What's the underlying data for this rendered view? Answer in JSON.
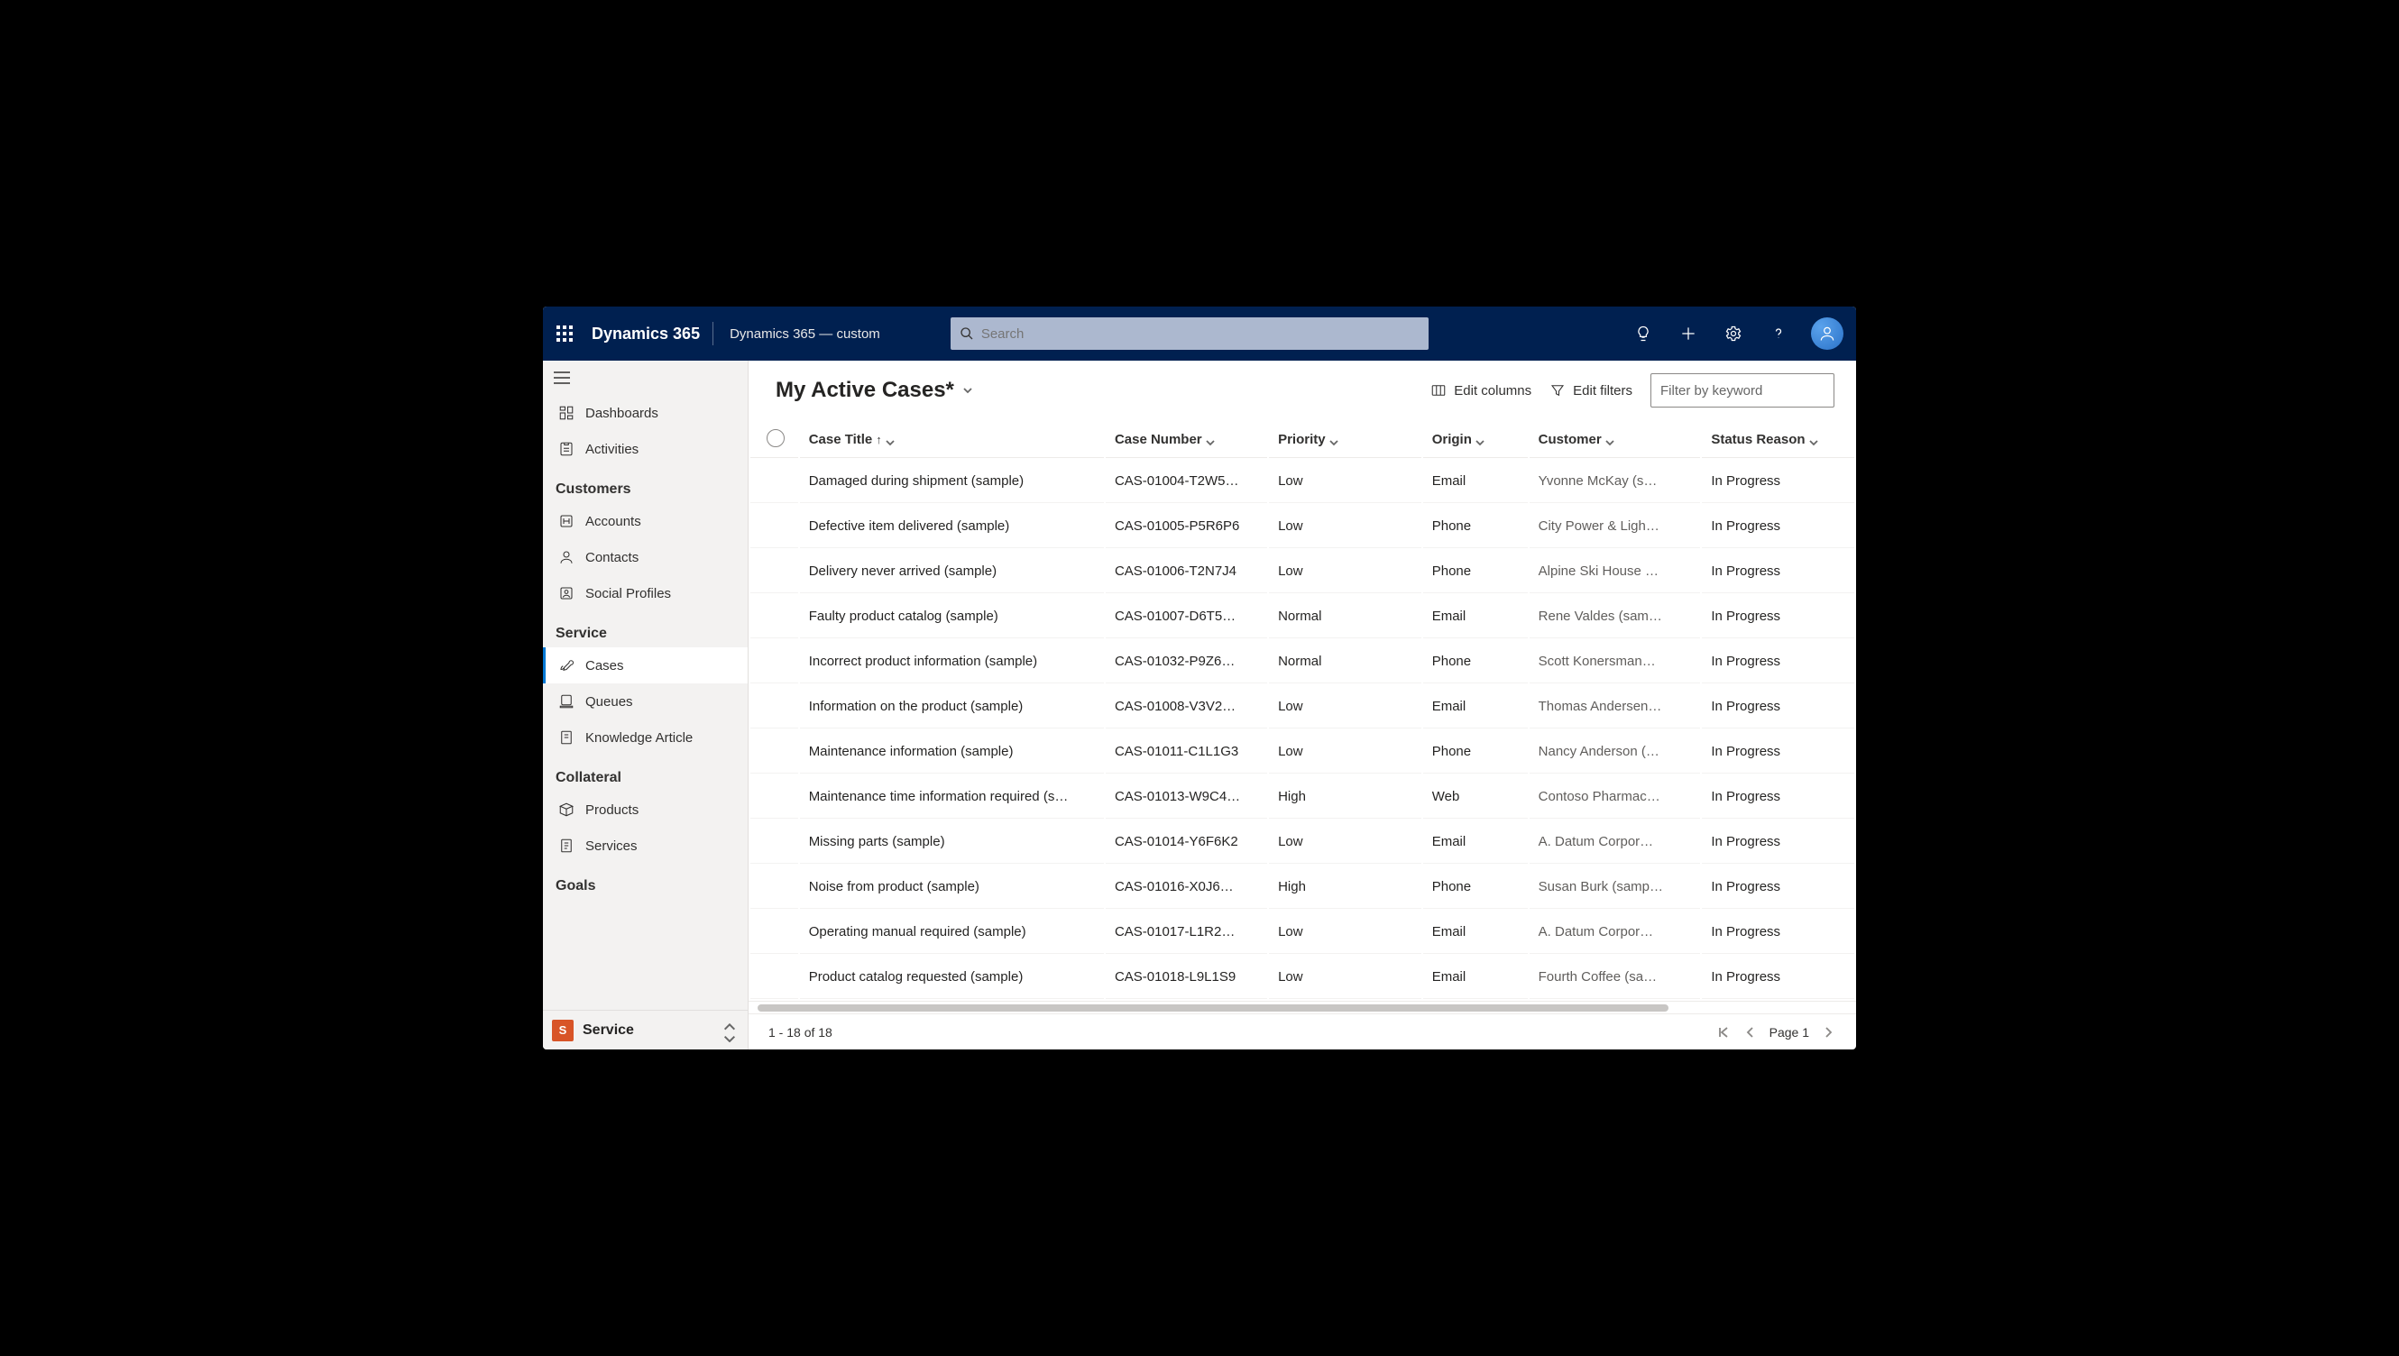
{
  "topnav": {
    "brand": "Dynamics 365",
    "subbrand": "Dynamics 365 — custom",
    "search_placeholder": "Search"
  },
  "sidebar": {
    "top": [
      {
        "label": "Dashboards",
        "icon": "dashboards"
      },
      {
        "label": "Activities",
        "icon": "activities"
      }
    ],
    "groups": [
      {
        "title": "Customers",
        "items": [
          {
            "label": "Accounts",
            "icon": "accounts"
          },
          {
            "label": "Contacts",
            "icon": "contacts"
          },
          {
            "label": "Social Profiles",
            "icon": "social"
          }
        ]
      },
      {
        "title": "Service",
        "items": [
          {
            "label": "Cases",
            "icon": "cases",
            "selected": true
          },
          {
            "label": "Queues",
            "icon": "queues"
          },
          {
            "label": "Knowledge Article",
            "icon": "knowledge"
          }
        ]
      },
      {
        "title": "Collateral",
        "items": [
          {
            "label": "Products",
            "icon": "products"
          },
          {
            "label": "Services",
            "icon": "services"
          }
        ]
      },
      {
        "title": "Goals",
        "items": []
      }
    ],
    "app_switcher": {
      "initial": "S",
      "label": "Service"
    }
  },
  "viewbar": {
    "title": "My Active Cases*",
    "edit_columns": "Edit columns",
    "edit_filters": "Edit filters",
    "filter_placeholder": "Filter by keyword"
  },
  "grid": {
    "columns": [
      {
        "key": "title",
        "label": "Case Title",
        "sorted": "asc"
      },
      {
        "key": "number",
        "label": "Case Number"
      },
      {
        "key": "priority",
        "label": "Priority"
      },
      {
        "key": "origin",
        "label": "Origin"
      },
      {
        "key": "customer",
        "label": "Customer"
      },
      {
        "key": "status",
        "label": "Status Reason"
      }
    ],
    "rows": [
      {
        "title": "Damaged during shipment (sample)",
        "number": "CAS-01004-T2W5…",
        "priority": "Low",
        "origin": "Email",
        "customer": "Yvonne McKay (s…",
        "status": "In Progress"
      },
      {
        "title": "Defective item delivered (sample)",
        "number": "CAS-01005-P5R6P6",
        "priority": "Low",
        "origin": "Phone",
        "customer": "City Power & Ligh…",
        "status": "In Progress"
      },
      {
        "title": "Delivery never arrived (sample)",
        "number": "CAS-01006-T2N7J4",
        "priority": "Low",
        "origin": "Phone",
        "customer": "Alpine Ski House …",
        "status": "In Progress"
      },
      {
        "title": "Faulty product catalog (sample)",
        "number": "CAS-01007-D6T5…",
        "priority": "Normal",
        "origin": "Email",
        "customer": "Rene Valdes (sam…",
        "status": "In Progress"
      },
      {
        "title": "Incorrect product information (sample)",
        "number": "CAS-01032-P9Z6…",
        "priority": "Normal",
        "origin": "Phone",
        "customer": "Scott Konersman…",
        "status": "In Progress"
      },
      {
        "title": "Information on the product (sample)",
        "number": "CAS-01008-V3V2…",
        "priority": "Low",
        "origin": "Email",
        "customer": "Thomas Andersen…",
        "status": "In Progress"
      },
      {
        "title": "Maintenance information (sample)",
        "number": "CAS-01011-C1L1G3",
        "priority": "Low",
        "origin": "Phone",
        "customer": "Nancy Anderson (…",
        "status": "In Progress"
      },
      {
        "title": "Maintenance time information required (s…",
        "number": "CAS-01013-W9C4…",
        "priority": "High",
        "origin": "Web",
        "customer": "Contoso Pharmac…",
        "status": "In Progress"
      },
      {
        "title": "Missing parts (sample)",
        "number": "CAS-01014-Y6F6K2",
        "priority": "Low",
        "origin": "Email",
        "customer": "A. Datum Corpor…",
        "status": "In Progress"
      },
      {
        "title": "Noise from product (sample)",
        "number": "CAS-01016-X0J6…",
        "priority": "High",
        "origin": "Phone",
        "customer": "Susan Burk (samp…",
        "status": "In Progress"
      },
      {
        "title": "Operating manual required (sample)",
        "number": "CAS-01017-L1R2…",
        "priority": "Low",
        "origin": "Email",
        "customer": "A. Datum Corpor…",
        "status": "In Progress"
      },
      {
        "title": "Product catalog requested (sample)",
        "number": "CAS-01018-L9L1S9",
        "priority": "Low",
        "origin": "Email",
        "customer": "Fourth Coffee (sa…",
        "status": "In Progress"
      }
    ]
  },
  "footer": {
    "range": "1 - 18 of 18",
    "page": "Page 1"
  }
}
